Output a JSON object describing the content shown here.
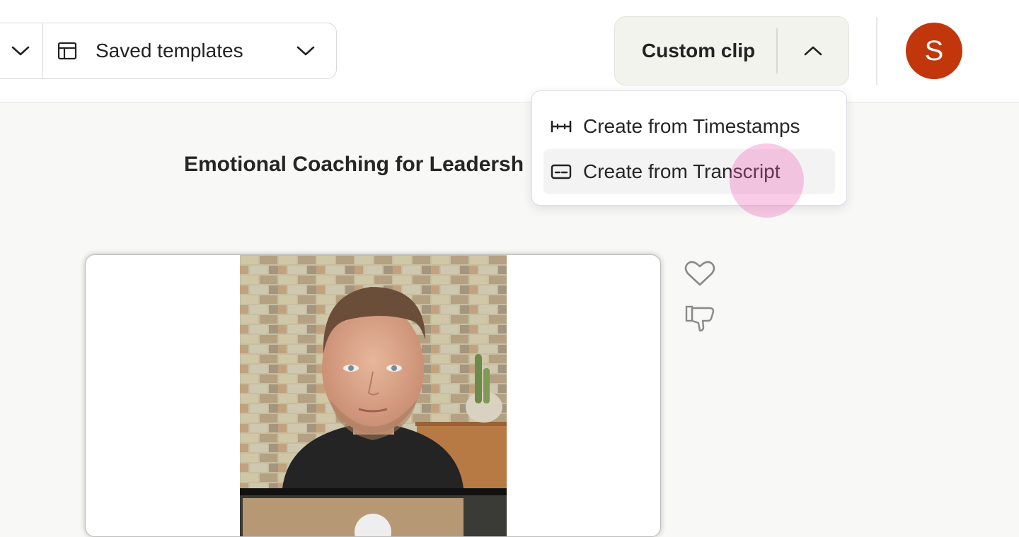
{
  "templates": {
    "label": "Saved templates"
  },
  "clip": {
    "label": "Custom clip"
  },
  "user": {
    "initial": "S",
    "color": "#c2360c"
  },
  "title": "Emotional Coaching for Leadersh",
  "menu": {
    "items": [
      {
        "label": "Create from Timestamps",
        "icon": "timestamps-icon"
      },
      {
        "label": "Create from Transcript",
        "icon": "transcript-icon"
      }
    ]
  },
  "actions": {
    "like_icon": "heart-icon",
    "dislike_icon": "thumbs-down-icon"
  }
}
